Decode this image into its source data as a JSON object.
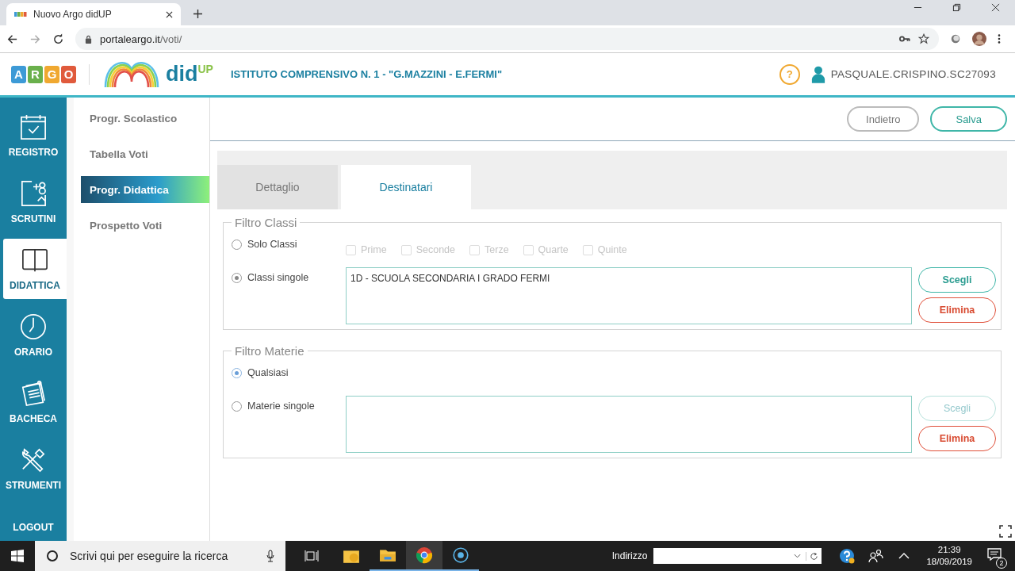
{
  "browser": {
    "tab_title": "Nuovo Argo didUP",
    "url_host": "portaleargo.it",
    "url_path": "/voti/",
    "forward_disabled": true
  },
  "header": {
    "logo_letters": [
      {
        "letter": "A",
        "color": "#3d9ad6"
      },
      {
        "letter": "R",
        "color": "#6ab04c"
      },
      {
        "letter": "G",
        "color": "#f0a830"
      },
      {
        "letter": "O",
        "color": "#e05a3c"
      }
    ],
    "app_name": "did$^{UP}$",
    "institute": "ISTITUTO COMPRENSIVO N. 1 - \"G.MAZZINI - E.FERMI\"",
    "help": "?",
    "user": "PASQUALE.CRISPINO.SC27093"
  },
  "nav_rail": [
    {
      "label": "REGISTRO",
      "kind": "calendar",
      "selected": false
    },
    {
      "label": "SCRUTINI",
      "kind": "scrutini",
      "selected": false
    },
    {
      "label": "DIDATTICA",
      "kind": "book",
      "selected": true
    },
    {
      "label": "ORARIO",
      "kind": "clock",
      "selected": false
    },
    {
      "label": "BACHECA",
      "kind": "board",
      "selected": false
    },
    {
      "label": "STRUMENTI",
      "kind": "tools",
      "selected": false
    },
    {
      "label": "LOGOUT",
      "kind": "logout",
      "selected": false
    }
  ],
  "submenu": [
    {
      "label": "Progr. Scolastico",
      "selected": false
    },
    {
      "label": "Tabella Voti",
      "selected": false
    },
    {
      "label": "Progr. Didattica",
      "selected": true
    },
    {
      "label": "Prospetto Voti",
      "selected": false
    }
  ],
  "actions": [
    {
      "label": "Indietro",
      "kind": "neutral"
    },
    {
      "label": "Salva",
      "kind": "primary"
    }
  ],
  "tabs": [
    {
      "label": "Dettaglio",
      "selected": false
    },
    {
      "label": "Destinatari",
      "selected": true
    }
  ],
  "filters": [
    {
      "legend": "Filtro Classi",
      "options": [
        {
          "label": "Solo Classi",
          "selected": false
        },
        {
          "label": "Classi singole",
          "selected": true
        }
      ],
      "checkboxes": [
        {
          "label": "Prime",
          "checked": false,
          "disabled": true
        },
        {
          "label": "Seconde",
          "checked": false,
          "disabled": true
        },
        {
          "label": "Terze",
          "checked": false,
          "disabled": true
        },
        {
          "label": "Quarte",
          "checked": false,
          "disabled": true
        },
        {
          "label": "Quinte",
          "checked": false,
          "disabled": true
        }
      ],
      "list_value": "1D - SCUOLA SECONDARIA I GRADO FERMI",
      "buttons": [
        {
          "label": "Scegli",
          "kind": "choose",
          "disabled": false
        },
        {
          "label": "Elimina",
          "kind": "delete",
          "disabled": false
        }
      ]
    },
    {
      "legend": "Filtro Materie",
      "options": [
        {
          "label": "Qualsiasi",
          "selected": true
        },
        {
          "label": "Materie singole",
          "selected": false
        }
      ],
      "buttons": [
        {
          "label": "Scegli",
          "kind": "choose",
          "disabled": true
        },
        {
          "label": "Elimina",
          "kind": "delete",
          "disabled": false
        }
      ]
    }
  ],
  "taskbar": {
    "search_placeholder": "Scrivi qui per eseguire la ricerca",
    "address_label": "Indirizzo",
    "time": "21:39",
    "date": "18/09/2019",
    "notifications": "2"
  }
}
